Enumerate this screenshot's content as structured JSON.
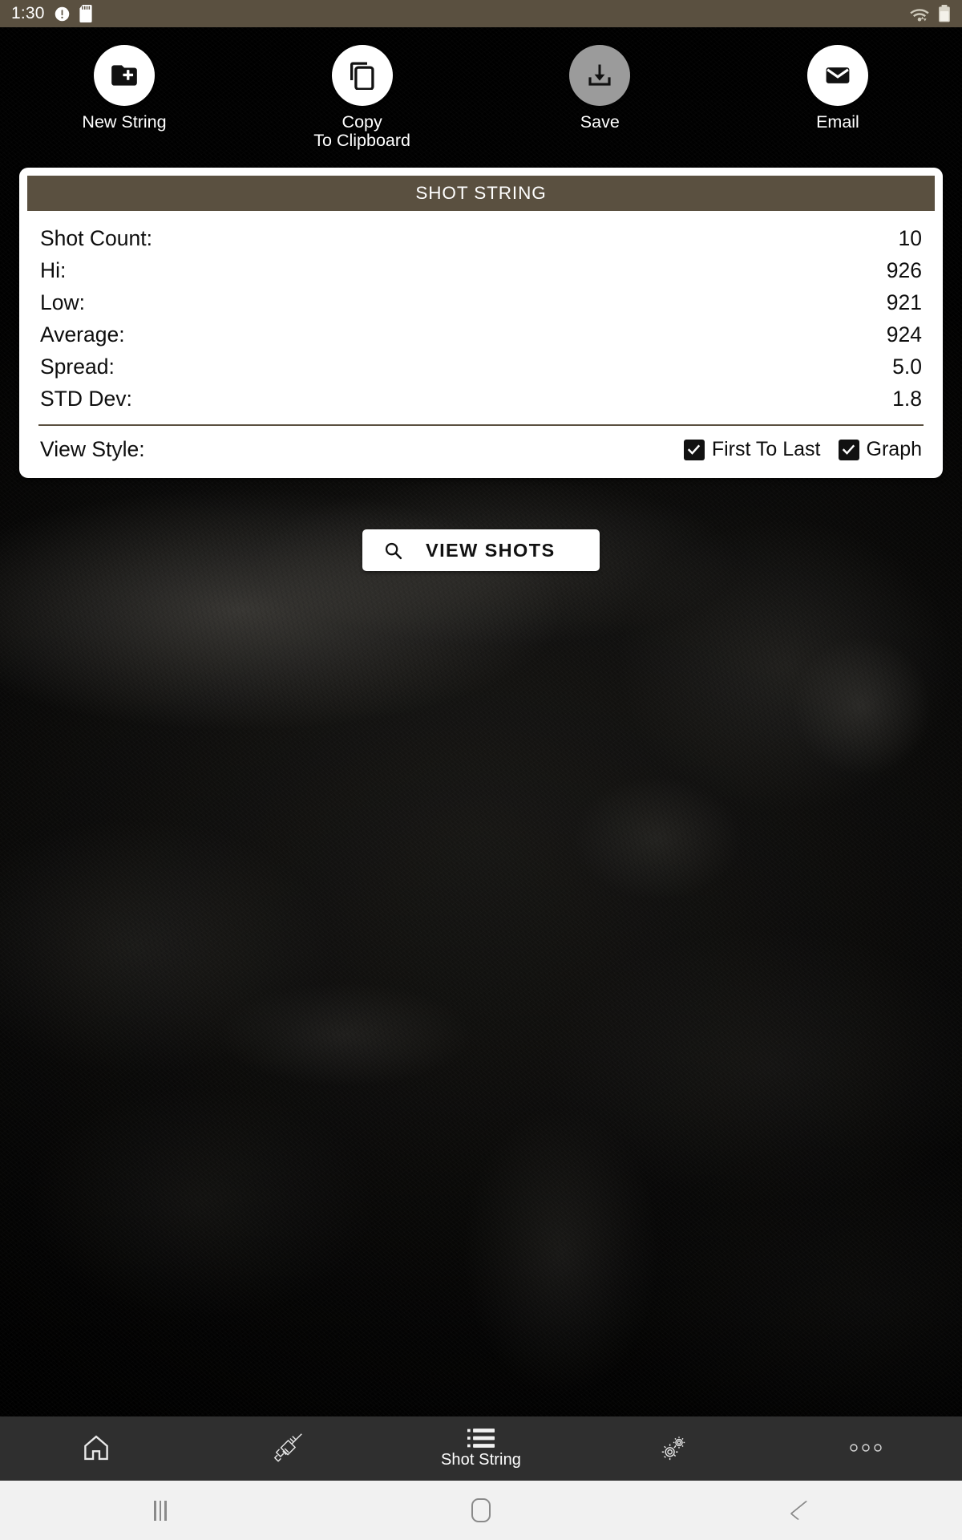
{
  "status_bar": {
    "clock": "1:30",
    "left_icons": [
      "alert-circle-icon",
      "sd-card-icon"
    ],
    "right_icons": [
      "wifi-icon",
      "battery-icon"
    ],
    "background_color": "#5a5040"
  },
  "actions": [
    {
      "label": "New String",
      "icon": "create-new-folder-icon",
      "enabled": true,
      "bubble_color": "#ffffff"
    },
    {
      "label": "Copy\nTo Clipboard",
      "icon": "copy-icon",
      "enabled": true,
      "bubble_color": "#ffffff"
    },
    {
      "label": "Save",
      "icon": "save-alt-download-icon",
      "enabled": false,
      "bubble_color": "#9b9b9b"
    },
    {
      "label": "Email",
      "icon": "email-envelope-icon",
      "enabled": true,
      "bubble_color": "#ffffff"
    }
  ],
  "card": {
    "title": "SHOT STRING",
    "title_color": "#5a5040",
    "stats": [
      {
        "label": "Shot Count:",
        "value": "10"
      },
      {
        "label": "Hi:",
        "value": "926"
      },
      {
        "label": "Low:",
        "value": "921"
      },
      {
        "label": "Average:",
        "value": "924"
      },
      {
        "label": "Spread:",
        "value": "5.0"
      },
      {
        "label": "STD Dev:",
        "value": "1.8"
      }
    ],
    "view_style": {
      "label": "View Style:",
      "options": [
        {
          "label": "First To Last",
          "checked": true
        },
        {
          "label": "Graph",
          "checked": true
        }
      ]
    }
  },
  "view_shots_button": {
    "label": "VIEW SHOTS",
    "icon": "search-magnifier-icon"
  },
  "app_nav": {
    "background_color": "#2f2f2f",
    "items": [
      {
        "icon": "home-icon",
        "label": "",
        "active": false
      },
      {
        "icon": "rifle-icon",
        "label": "",
        "active": false
      },
      {
        "icon": "list-icon",
        "label": "Shot String",
        "active": true
      },
      {
        "icon": "gears-icon",
        "label": "",
        "active": false
      },
      {
        "icon": "more-dots-icon",
        "label": "",
        "active": false
      }
    ]
  },
  "system_nav": {
    "background_color": "#f1f1f1",
    "buttons": [
      "recents-icon",
      "home-icon",
      "back-icon"
    ]
  }
}
